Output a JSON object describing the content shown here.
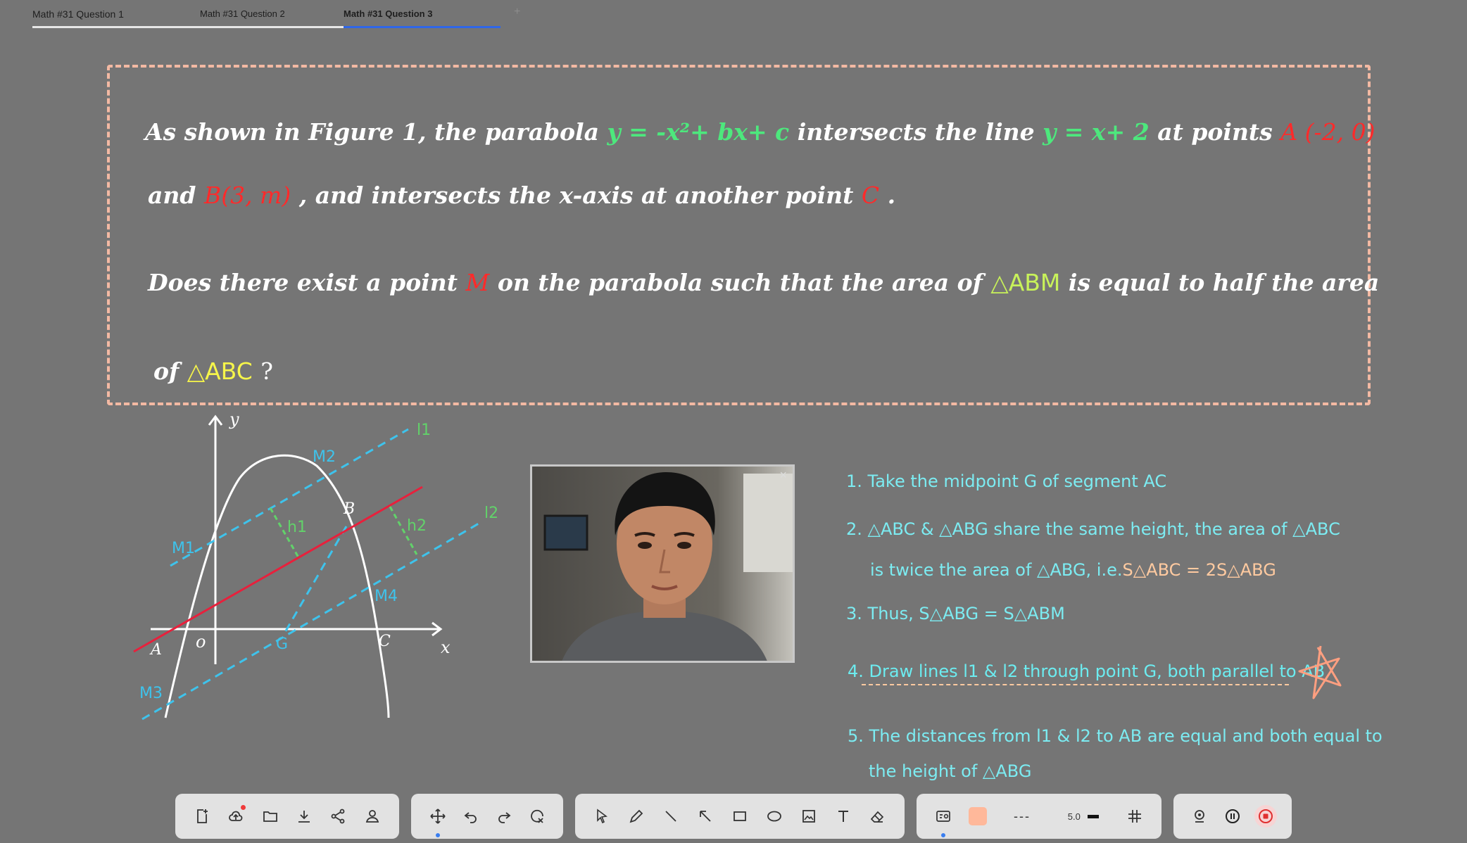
{
  "tabs": [
    {
      "label": "Math #31 Question 1",
      "active": false
    },
    {
      "label": "Math #31 Question 2",
      "active": false
    },
    {
      "label": "Math #31 Question 3",
      "active": true
    }
  ],
  "tab_add": "+",
  "question": {
    "l1_a": "As shown in Figure 1, the parabola",
    "l1_eq1": "y = -x²+ bx+ c",
    "l1_b": "intersects the line",
    "l1_eq2": "y = x+ 2",
    "l1_c": "at points",
    "l1_pa": "A (-2, 0)",
    "l2_a": "and",
    "l2_pb": "B(3, m)",
    "l2_b": ", and intersects the x-axis at another point",
    "l2_pc": "C",
    "l2_c": ".",
    "l3_a": "Does there exist a point",
    "l3_m": "M",
    "l3_b": "on the parabola such that the area of",
    "l3_abm": "△ABM",
    "l3_c": "is equal to half the area",
    "l4_a": "of",
    "l4_abc": "△ABC",
    "l4_b": "?"
  },
  "diagram": {
    "y_axis": "y",
    "x_axis": "x",
    "origin": "o",
    "A": "A",
    "B": "B",
    "C": "C",
    "G": "G",
    "M1": "M1",
    "M2": "M2",
    "M3": "M3",
    "M4": "M4",
    "h1": "h1",
    "h2": "h2",
    "l1": "l1",
    "l2": "l2"
  },
  "photo": {
    "close": "×"
  },
  "steps": [
    "1. Take the midpoint G of segment AC",
    "2. △ABC & △ABG share the same height, the area of △ABC",
    "is twice the area of △ABG, i.e.",
    "S△ABC = 2S△ABG",
    "3. Thus, S△ABG = S△ABM",
    "4. Draw lines l1 & l2 through point G, both parallel to AB",
    "5. The distances from l1 & l2 to AB are equal and both equal to",
    "the height of △ABG"
  ],
  "toolbar": {
    "dash_style": "---",
    "stroke_width": "5.0",
    "colors": {
      "swatch": "#ffb89a",
      "record": "#e03030"
    }
  }
}
